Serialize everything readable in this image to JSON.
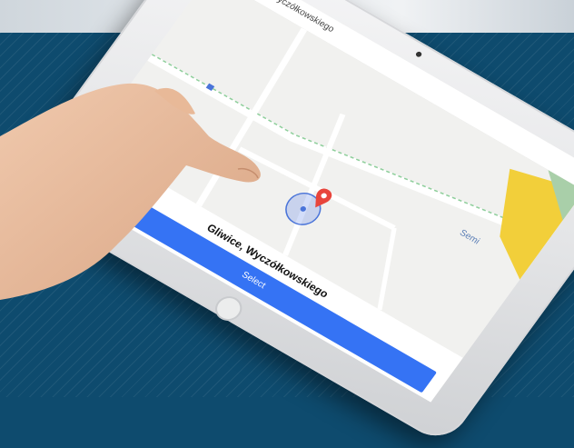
{
  "header": {
    "title": "Gliwice, Wyczółkowskiego"
  },
  "map": {
    "street_label": "Semi"
  },
  "bottom_sheet": {
    "address": "Gliwice, Wyczółkowskiego",
    "select_label": "Select"
  },
  "colors": {
    "background": "#0e4b6e",
    "accent": "#3573f4",
    "marker": "#e8453c"
  },
  "icons": [
    "back-arrow-icon",
    "location-pin-icon",
    "camera-icon",
    "home-button-icon"
  ]
}
